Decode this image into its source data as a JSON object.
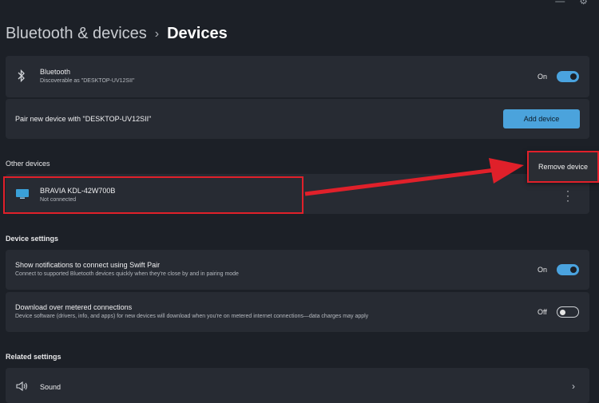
{
  "breadcrumb": {
    "parent": "Bluetooth & devices",
    "separator": "›",
    "current": "Devices"
  },
  "bluetooth": {
    "title": "Bluetooth",
    "subtitle": "Discoverable as \"DESKTOP-UV12SII\"",
    "toggle_label": "On",
    "toggle_state": "on"
  },
  "pair": {
    "text": "Pair new device with \"DESKTOP-UV12SII\"",
    "button": "Add device"
  },
  "other_devices": {
    "heading": "Other devices",
    "device": {
      "name": "BRAVIA KDL-42W700B",
      "status": "Not connected"
    },
    "context_menu": {
      "remove": "Remove device"
    }
  },
  "device_settings": {
    "heading": "Device settings",
    "swift_pair": {
      "title": "Show notifications to connect using Swift Pair",
      "subtitle": "Connect to supported Bluetooth devices quickly when they're close by and in pairing mode",
      "toggle_label": "On",
      "toggle_state": "on"
    },
    "metered": {
      "title": "Download over metered connections",
      "subtitle": "Device software (drivers, info, and apps) for new devices will download when you're on metered internet connections—data charges may apply",
      "toggle_label": "Off",
      "toggle_state": "off"
    }
  },
  "related_settings": {
    "heading": "Related settings",
    "sound": "Sound"
  },
  "colors": {
    "accent": "#4aa3df",
    "annotation": "#e0202a",
    "background": "#1c2027",
    "card": "#272b33"
  },
  "icons": [
    "bluetooth-icon",
    "monitor-icon",
    "speaker-icon",
    "more-icon",
    "chevron-right-icon"
  ]
}
